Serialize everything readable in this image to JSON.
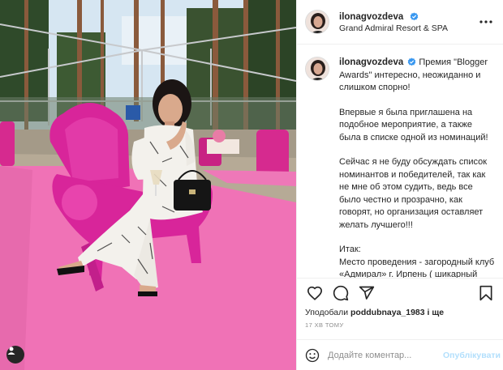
{
  "header": {
    "username": "ilonagvozdeva",
    "location": "Grand Admiral Resort & SPA"
  },
  "caption": {
    "username": "ilonagvozdeva",
    "paragraphs": [
      "Премия \"Blogger Awards\" интересно, неожиданно и слишком спорно!",
      "Впервые я была приглашена на подобное мероприятие, а также была в списке одной из номинаций!",
      "Сейчас я не буду обсуждать список номинантов и победителей, так как не мне об этом судить, ведь все было честно и прозрачно, как говорят, но организация оставляет желать лучшего!!!",
      "Итак:\nМесто проведения - загородный клуб «Адмирал» г. Ирпень ( шикарный комплекс, отличная территория, но грязный бассейн"
    ]
  },
  "likes": {
    "prefix": "Уподобали",
    "user": "poddubnaya_1983",
    "suffix": "і ще"
  },
  "timestamp": "17 хв тому",
  "comment_box": {
    "placeholder": "Додайте коментар...",
    "post_label": "Опублікувати"
  },
  "icons": {
    "verified": "verified-badge-icon",
    "more": "more-options-icon",
    "like": "heart-icon",
    "comment": "comment-icon",
    "share": "paper-plane-icon",
    "save": "bookmark-icon",
    "emoji": "smiley-icon",
    "tag": "user-tag-icon"
  },
  "colors": {
    "verified_blue": "#3897f0",
    "post_button_disabled": "#b2dffc",
    "muted_text": "#8e8e8e",
    "chair_magenta": "#d8259a",
    "carpet_pink": "#f06fb4"
  }
}
